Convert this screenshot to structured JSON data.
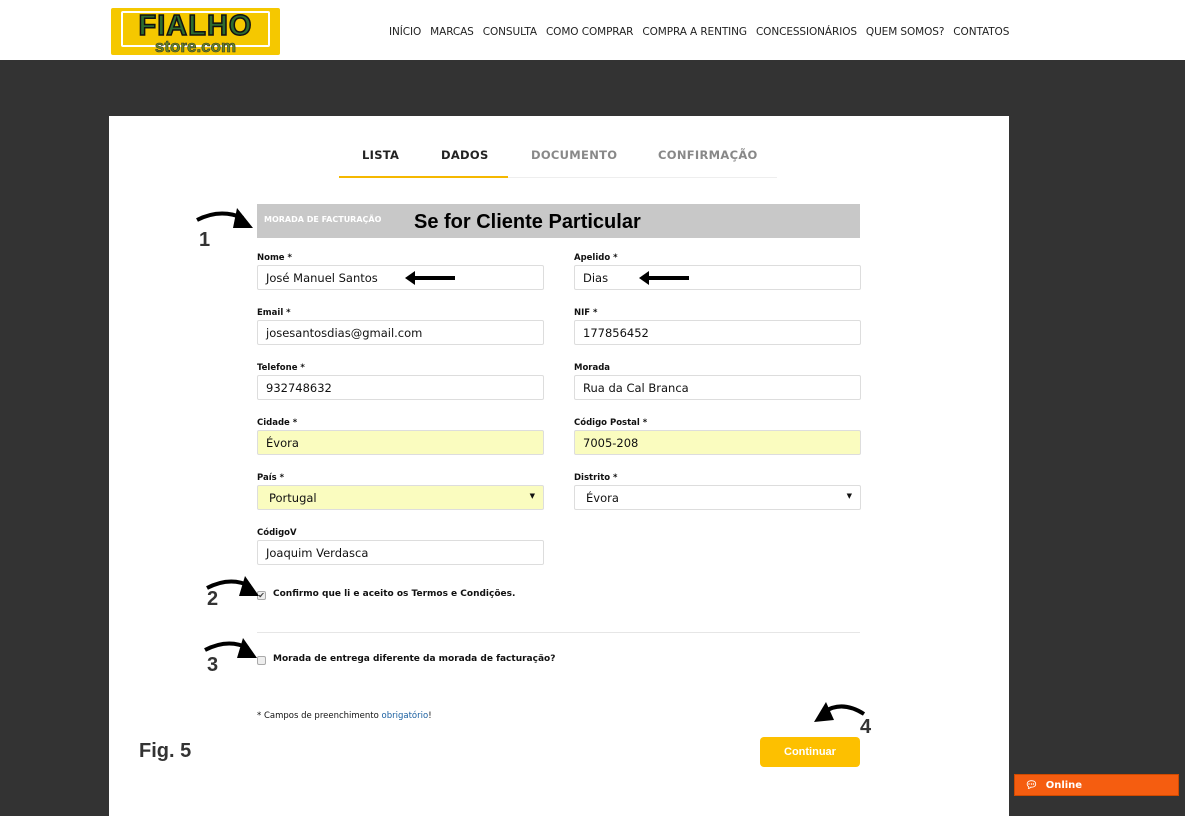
{
  "header": {
    "logo_text": "FIALHO",
    "logo_sub": "store.com",
    "nav": [
      "INÍCIO",
      "MARCAS",
      "CONSULTA",
      "COMO COMPRAR",
      "COMPRA A RENTING",
      "CONCESSIONÁRIOS",
      "QUEM SOMOS?",
      "CONTATOS"
    ]
  },
  "tabs": [
    {
      "label": "LISTA",
      "color": "#222"
    },
    {
      "label": "DADOS",
      "color": "#222"
    },
    {
      "label": "DOCUMENTO",
      "color": "#888"
    },
    {
      "label": "CONFIRMAÇÃO",
      "color": "#888"
    }
  ],
  "section": {
    "title": "MORADA DE FACTURAÇÃO",
    "annotation": "Se for Cliente Particular"
  },
  "fields": {
    "nome": {
      "label": "Nome *",
      "value": "José Manuel Santos"
    },
    "apelido": {
      "label": "Apelido *",
      "value": "Dias"
    },
    "email": {
      "label": "Email *",
      "value": "josesantosdias@gmail.com"
    },
    "nif": {
      "label": "NIF *",
      "value": "177856452"
    },
    "telefone": {
      "label": "Telefone *",
      "value": "932748632"
    },
    "morada": {
      "label": "Morada",
      "value": "Rua da Cal Branca"
    },
    "cidade": {
      "label": "Cidade *",
      "value": "Évora"
    },
    "codigo_postal": {
      "label": "Código Postal *",
      "value": "7005-208"
    },
    "pais": {
      "label": "País *",
      "value": "Portugal"
    },
    "distrito": {
      "label": "Distrito *",
      "value": "Évora"
    },
    "codigov": {
      "label": "CódigoV",
      "value": "Joaquim Verdasca"
    }
  },
  "terms": {
    "label": "Confirmo que li e aceito os Termos e Condições.",
    "checked": true
  },
  "different_address": {
    "label": "Morada de entrega diferente da morada de facturação?",
    "checked": false
  },
  "note": {
    "prefix": "* Campos de preenchimento ",
    "link": "obrigatório",
    "suffix": "!"
  },
  "annotations": {
    "n1": "1",
    "n2": "2",
    "n3": "3",
    "n4": "4",
    "fig": "Fig. 5"
  },
  "continue_label": "Continuar",
  "chat": {
    "label": "Online",
    "color": "#f55d10"
  }
}
